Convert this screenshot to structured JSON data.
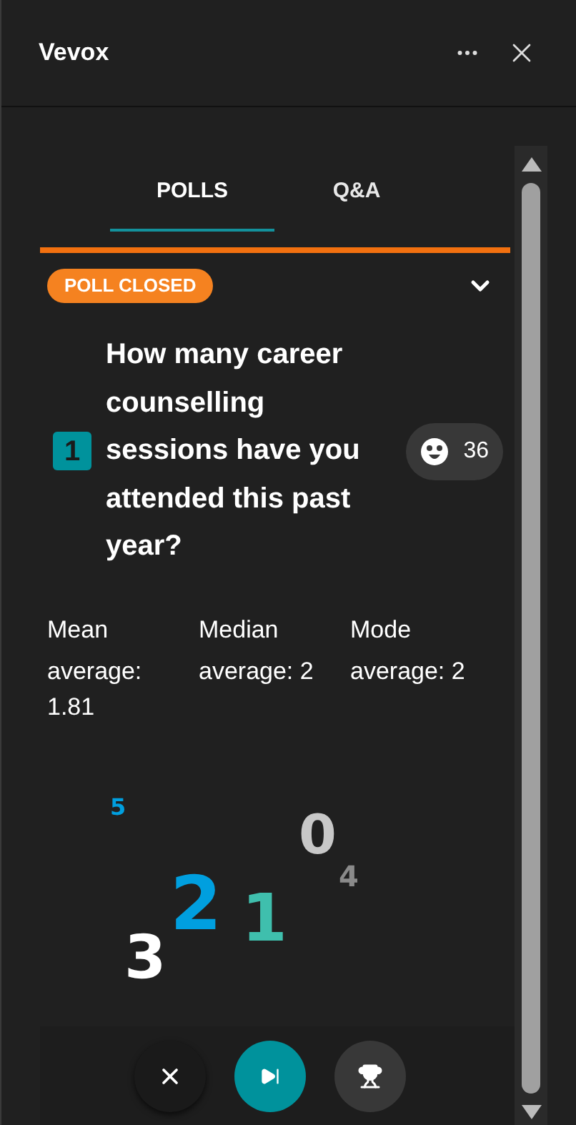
{
  "window": {
    "title": "Vevox"
  },
  "tabs": [
    {
      "label": "POLLS",
      "selected": true
    },
    {
      "label": "Q&A",
      "selected": false
    }
  ],
  "poll": {
    "status": "POLL CLOSED",
    "expanded": true,
    "number": "1",
    "question": "How many career counselling sessions have you attended this past year?",
    "responses": "36",
    "stats": [
      {
        "label": "Mean",
        "value": "average: 1.81"
      },
      {
        "label": "Median",
        "value": "average: 2"
      },
      {
        "label": "Mode",
        "value": "average: 2"
      }
    ],
    "word_cloud": [
      {
        "text": "5",
        "color": "#009fdf"
      },
      {
        "text": "0",
        "color": "#c8c8c8"
      },
      {
        "text": "4",
        "color": "#8a8a8a"
      },
      {
        "text": "2",
        "color": "#009fdf"
      },
      {
        "text": "1",
        "color": "#3fbfad"
      },
      {
        "text": "3",
        "color": "#ffffff"
      }
    ]
  }
}
